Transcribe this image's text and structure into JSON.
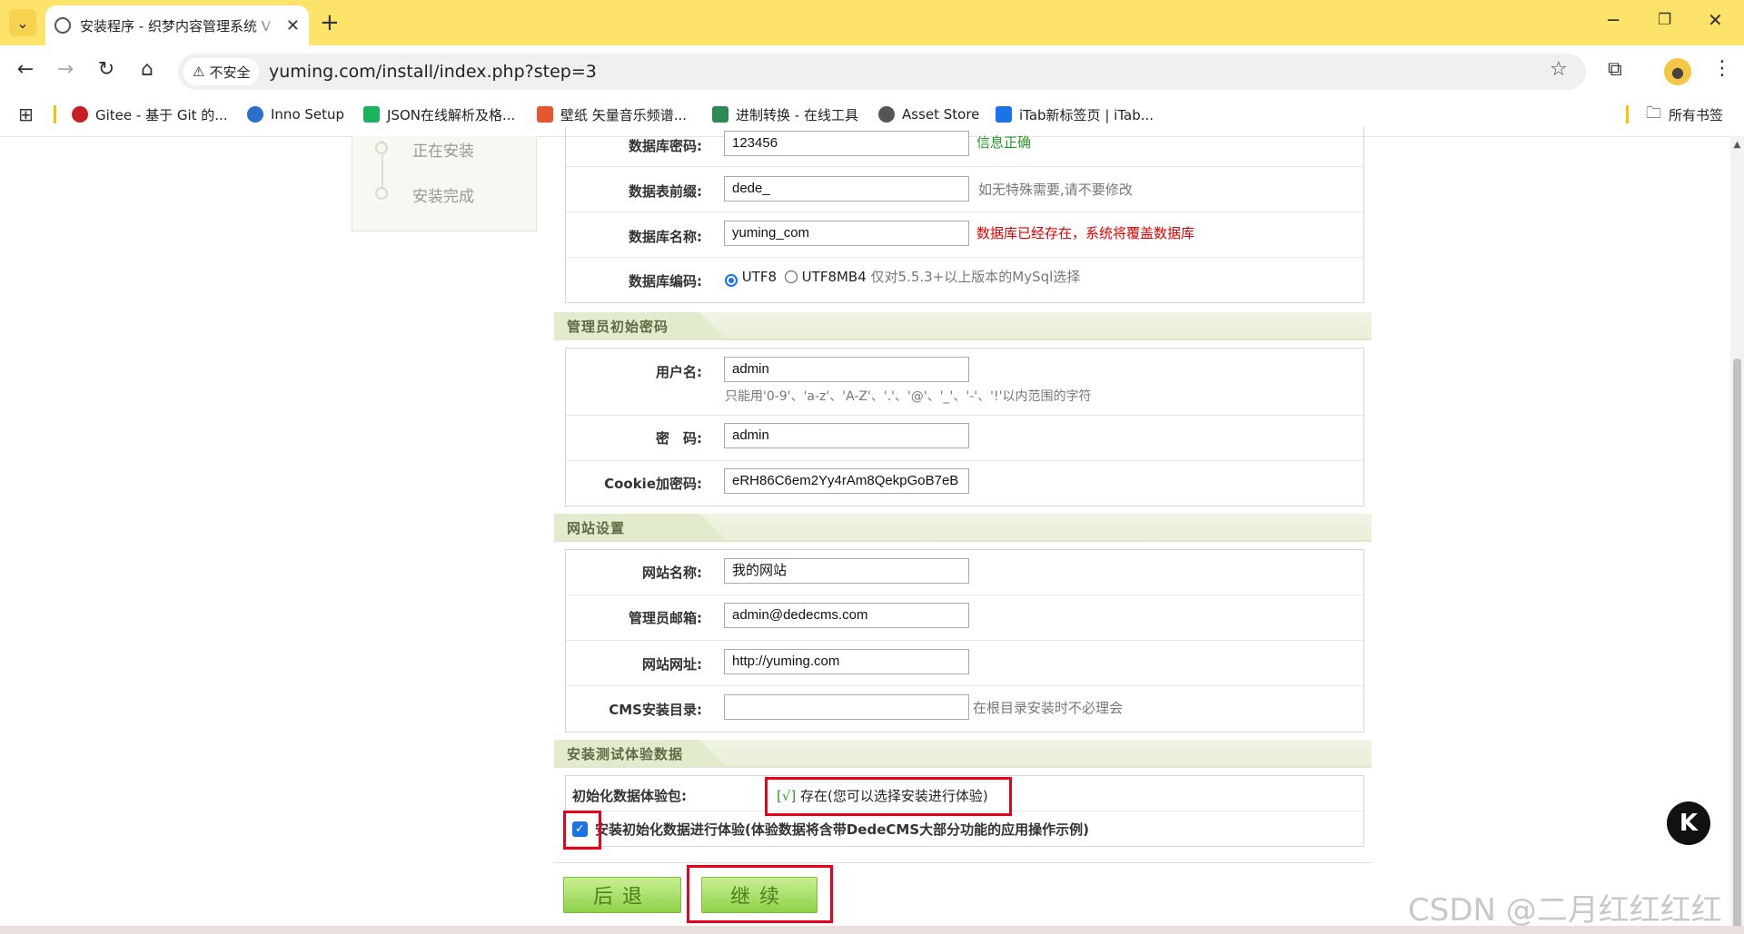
{
  "browser": {
    "tab_title": "安装程序 - 织梦内容管理系统 V",
    "insecure_label": "不安全",
    "url": "yuming.com/install/index.php?step=3"
  },
  "bookmarks": [
    {
      "label": "Gitee - 基于 Git 的...",
      "color": "#c71d23"
    },
    {
      "label": "Inno Setup",
      "color": "#2a6fc9"
    },
    {
      "label": "JSON在线解析及格...",
      "color": "#1bb45e"
    },
    {
      "label": "壁纸 矢量音乐频谱...",
      "color": "#e8552d"
    },
    {
      "label": "进制转换 - 在线工具",
      "color": "#2c8a54"
    },
    {
      "label": "Asset Store",
      "color": "#555555"
    },
    {
      "label": "iTab新标签页 | iTab...",
      "color": "#1a73e8"
    }
  ],
  "all_bookmarks": "所有书签",
  "steps": {
    "installing": "正在安装",
    "done": "安装完成"
  },
  "db": {
    "password_label": "数据库密码:",
    "password_value": "123456",
    "password_hint": "信息正确",
    "prefix_label": "数据表前缀:",
    "prefix_value": "dede_",
    "prefix_hint": "如无特殊需要,请不要修改",
    "name_label": "数据库名称:",
    "name_value": "yuming_com",
    "name_hint": "数据库已经存在，系统将覆盖数据库",
    "encoding_label": "数据库编码:",
    "encoding_opt1": "UTF8",
    "encoding_opt2": "UTF8MB4",
    "encoding_hint": "仅对5.5.3+以上版本的MySql选择"
  },
  "admin": {
    "section": "管理员初始密码",
    "user_label": "用户名:",
    "user_value": "admin",
    "user_hint": "只能用'0-9'、'a-z'、'A-Z'、'.'、'@'、'_'、'-'、'!'以内范围的字符",
    "pwd_label": "密　码:",
    "pwd_value": "admin",
    "cookie_label": "Cookie加密码:",
    "cookie_value": "eRH86C6em2Yy4rAm8QekpGoB7eB"
  },
  "site": {
    "section": "网站设置",
    "name_label": "网站名称:",
    "name_value": "我的网站",
    "email_label": "管理员邮箱:",
    "email_value": "admin@dedecms.com",
    "url_label": "网站网址:",
    "url_value": "http://yuming.com",
    "dir_label": "CMS安装目录:",
    "dir_value": "",
    "dir_hint": "在根目录安装时不必理会"
  },
  "demo": {
    "section": "安装测试体验数据",
    "pkg_label": "初始化数据体验包:",
    "pkg_check": "[√]",
    "pkg_status": "存在(您可以选择安装进行体验)",
    "install_label": "安装初始化数据进行体验(体验数据将含带DedeCMS大部分功能的应用操作示例)"
  },
  "buttons": {
    "back": "后退",
    "continue": "继续"
  },
  "watermark": "CSDN @二月红红红红",
  "colors": {
    "titlebar": "#fde36a",
    "button_green": "#8ed24a",
    "highlight_red": "#e8001c"
  }
}
